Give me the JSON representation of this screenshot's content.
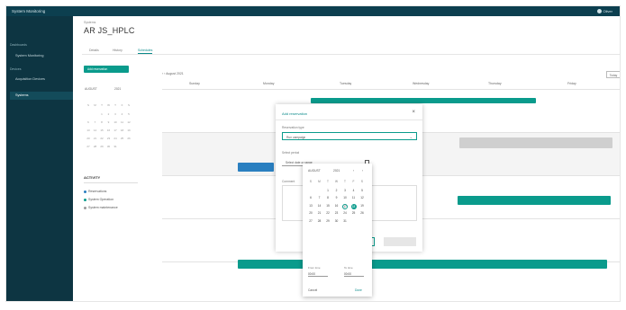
{
  "app": {
    "title": "System Monitoring",
    "user": "Oliver"
  },
  "sidebar": {
    "section_dashboards": "Dashboards",
    "item_system_monitoring": "System Monitoring",
    "section_devices": "Devices",
    "item_acquisition_devices": "Acquisition Devices",
    "item_systems": "Systems"
  },
  "page": {
    "breadcrumb": "Systems",
    "title": "AR JS_HPLC"
  },
  "tabs": [
    "Details",
    "History",
    "Schedules"
  ],
  "left_panel": {
    "add_button": "Add reservation",
    "mini_month": "AUGUST",
    "mini_year": "2021",
    "activity_title": "ACTIVITY",
    "legend": [
      {
        "label": "Reservations",
        "color": "#2a7fc0"
      },
      {
        "label": "System Operation",
        "color": "#0a9b8c"
      },
      {
        "label": "System maintenance",
        "color": "#9a9a9a"
      }
    ]
  },
  "calendar": {
    "range": "August 2021",
    "today_button": "Today",
    "weekdays": [
      "Sunday",
      "Monday",
      "Tuesday",
      "Wednesday",
      "Thursday",
      "Friday"
    ]
  },
  "modal": {
    "title": "Add reservation",
    "reservation_type_label": "Reservation type",
    "reservation_type_value": "Run campaign",
    "period_label": "Select period",
    "date_placeholder": "Select date or range",
    "comment_label": "Comment"
  },
  "picker": {
    "month": "AUGUST",
    "year": "2021",
    "weekday_initials": [
      "S",
      "M",
      "T",
      "W",
      "T",
      "F",
      "S"
    ],
    "days": [
      "",
      "",
      "1",
      "2",
      "3",
      "4",
      "5",
      "6",
      "7",
      "8",
      "9",
      "10",
      "11",
      "12",
      "13",
      "14",
      "15",
      "16",
      "17",
      "18",
      "19",
      "20",
      "21",
      "22",
      "23",
      "24",
      "25",
      "26",
      "27",
      "28",
      "29",
      "30",
      "31"
    ],
    "from_label": "From time",
    "from_value": "00:00",
    "to_label": "To time",
    "to_value": "00:00",
    "cancel": "Cancel",
    "done": "Done"
  }
}
